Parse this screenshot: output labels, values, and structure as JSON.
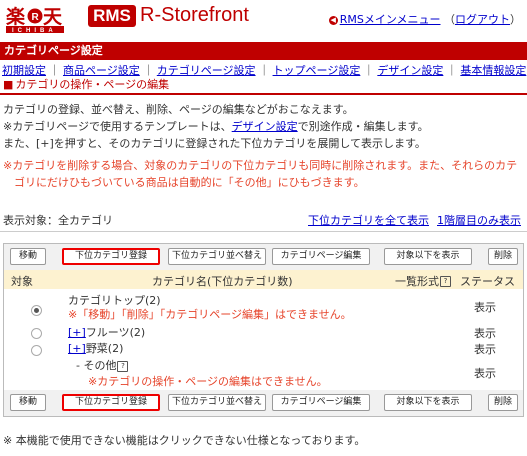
{
  "header": {
    "logo_text": "楽天 ICHIBA",
    "rms_badge": "RMS",
    "app_title": "R-Storefront",
    "main_menu_link": "RMSメインメニュー",
    "logout_open": "（",
    "logout_link": "ログアウト",
    "logout_close": "）"
  },
  "redbar_title": "カテゴリページ設定",
  "nav": [
    "初期設定",
    "商品ページ設定",
    "カテゴリページ設定",
    "トップページ設定",
    "デザイン設定",
    "基本情報設定"
  ],
  "nav_separator": "｜",
  "section": {
    "marker": "■",
    "title": "カテゴリの操作・ページの編集"
  },
  "description": {
    "line1": "カテゴリの登録、並べ替え、削除、ページの編集などがおこなえます。",
    "line2_prefix": "※カテゴリページで使用するテンプレートは、",
    "line2_link": "デザイン設定",
    "line2_suffix": "で別途作成・編集します。",
    "line3": "また、[+]を押すと、そのカテゴリに登録された下位カテゴリを展開して表示します。"
  },
  "warning": {
    "line1": "※カテゴリを削除する場合、対象のカテゴリの下位カテゴリも同時に削除されます。また、それらのカテ",
    "line2": "ゴリにだけひもづいている商品は自動的に「その他」にひもづきます。"
  },
  "display_target": "表示対象：全カテゴリ",
  "show_all_sub": "下位カテゴリを全て表示",
  "show_level1": "1階層目のみ表示",
  "buttons": {
    "move": "移動",
    "add_sub": "下位カテゴリ登録",
    "sort_sub": "下位カテゴリ並べ替え",
    "edit_page": "カテゴリページ編集",
    "show_below": "対象以下を表示",
    "delete": "削除"
  },
  "table": {
    "headers": {
      "target": "対象",
      "name": "カテゴリ名(下位カテゴリ数)",
      "list_format": "一覧形式",
      "status": "ステータス"
    },
    "rows": [
      {
        "name": "カテゴリトップ(2)",
        "note": "※「移動」「削除」「カテゴリページ編集」はできません。",
        "status": "表示"
      },
      {
        "expand": "[+]",
        "name": "フルーツ(2)",
        "status": "表示"
      },
      {
        "expand": "[+]",
        "name": "野菜(2)",
        "status": "表示"
      },
      {
        "prefix": "- ",
        "name": "その他",
        "note": "※カテゴリの操作・ページの編集はできません。",
        "status": "表示"
      }
    ]
  },
  "footer_note": "※ 本機能で使用できない機能はクリックできない仕様となっております。",
  "colors": {
    "brand_red": "#bf0000",
    "warning_red": "#e6442b",
    "header_bg": "#fdf2d0"
  }
}
